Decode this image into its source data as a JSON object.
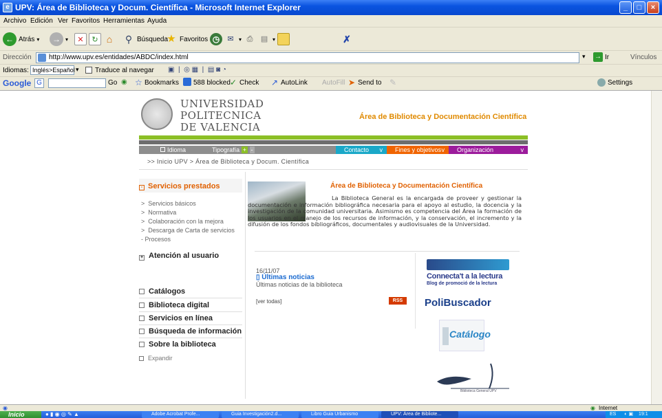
{
  "window": {
    "title": "UPV: Área de Biblioteca y Docum. Científica - Microsoft Internet Explorer",
    "controls": [
      "_",
      "□",
      "×"
    ]
  },
  "menu": [
    "Archivo",
    "Edición",
    "Ver",
    "Favoritos",
    "Herramientas",
    "Ayuda"
  ],
  "toolbar": {
    "back": "Atrás",
    "search": "Búsqueda",
    "favorites": "Favoritos"
  },
  "address": {
    "label": "Dirección",
    "url": "http://www.upv.es/entidades/ABDC/index.html",
    "go": "Ir",
    "links": "Vínculos"
  },
  "langbar": {
    "label": "Idiomas:",
    "selected": "Inglés>Español",
    "translate": "Traduce al navegar"
  },
  "googlebar": {
    "go": "Go",
    "bookmarks": "Bookmarks",
    "blocked": "588 blocked",
    "check": "Check",
    "autolink": "AutoLink",
    "autofill": "AutoFill",
    "sendto": "Send to",
    "settings": "Settings"
  },
  "page": {
    "logo_lines": [
      "UNIVERSIDAD",
      "POLITECNICA",
      "DE VALENCIA"
    ],
    "header_title": "Área de Biblioteca y Documentación Científica",
    "nav": {
      "idioma": "Idioma",
      "tipografia": "Tipografía",
      "contacto": "Contacto",
      "fines": "Fines y objetivos",
      "organizacion": "Organización"
    },
    "breadcrumb": ">> Inicio UPV > Área de Biblioteca y Docum. Científica",
    "sidebar": {
      "section1": "Servicios prestados",
      "subitems": [
        "Servicios básicos",
        "Normativa",
        "Colaboración con la mejora",
        "Descarga de Carta de servicios"
      ],
      "procesos": "Procesos",
      "section2": "Atención al usuario",
      "items": [
        "Catálogos",
        "Biblioteca digital",
        "Servicios en línea",
        "Búsqueda de información",
        "Sobre la biblioteca"
      ],
      "expand": "Expandir"
    },
    "intro_title": "Área de Biblioteca y Documentación Científica",
    "intro_text": "La Biblioteca General es la encargada de proveer y gestionar la documentación e información bibliográfica necesaria para el apoyo al estudio, la docencia y la investigación de la comunidad universitaria. Asimismo es competencia del Área la formación de los usuarios en el manejo de los recursos de información, y la conservación, el incremento y la difusión de los fondos bibliográficos, documentales y audiovisuales de la Universidad.",
    "news": {
      "date": "16/11/07",
      "title": "Últimas noticias",
      "desc": "Últimas noticias de la biblioteca",
      "all": "[ver todas]",
      "rss": "RSS"
    },
    "promos": {
      "connecta_title": "Connecta't a la lectura",
      "connecta_sub": "Blog de promoció de la lectura",
      "polibuscador": "PoliBuscador",
      "catalogo": "Catálogo",
      "biblio": "Biblioteca General UPV"
    }
  },
  "status": {
    "zone": "Internet"
  },
  "taskbar": {
    "start": "Inicio",
    "tasks": [
      "Adobe Acrobat Profe...",
      "Guia Investigación2.d...",
      "Libro Guia Urbanismo",
      "UPV: Área de Bibliote..."
    ],
    "lang": "ES",
    "clock": "19:1"
  },
  "colors": {
    "accent_orange": "#e08a00",
    "green_bar": "#8cbf26",
    "nav_gray": "#8e8e8e",
    "nav_teal": "#1aa8c8",
    "nav_orange": "#f06400",
    "nav_purple": "#9c1c9c"
  }
}
